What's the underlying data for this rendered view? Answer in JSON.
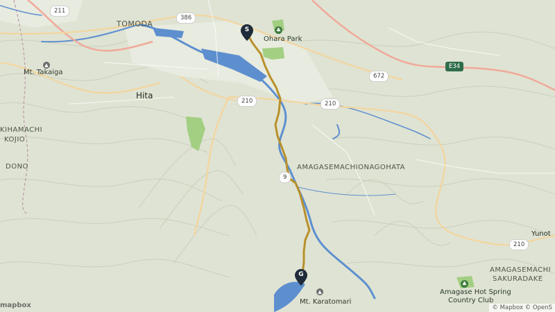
{
  "map": {
    "place_labels": [
      "TOMODA",
      "Hita",
      "KIHAMACHI",
      "KOJIO",
      "DONO",
      "AMAGASEMACHIONAGOHATA",
      "AMAGASEMACHI",
      "SAKURADAKE",
      "Yunot"
    ],
    "park_labels": {
      "ohara": "Ohara Park",
      "hot_spring_line1": "Amagase Hot Spring",
      "hot_spring_line2": "Country Club"
    },
    "mountain_labels": {
      "takaiga": "Mt. Takaiga",
      "karatomari": "Mt. Karatomari"
    },
    "road_shields": {
      "r211": "211",
      "r386": "386",
      "r210a": "210",
      "r210b": "210",
      "r210c": "210",
      "r210d": "210",
      "r672": "672",
      "r9": "9",
      "e34": "E34"
    },
    "markers": {
      "start": "S",
      "goal": "G"
    },
    "logo": "mapbox",
    "attribution": "© Mapbox © OpenS"
  },
  "colors": {
    "terrain": "#dfe3d3",
    "water": "#5d8fcf",
    "route": "#b8902a",
    "highway": "#f0a99a",
    "main_road": "#f5d49a",
    "park": "#9ccc7a",
    "marker": "#1f2a3a"
  },
  "icons": {
    "park": "park-icon",
    "mountain": "mountain-icon",
    "start_marker": "start-pin-icon",
    "goal_marker": "goal-pin-icon"
  }
}
